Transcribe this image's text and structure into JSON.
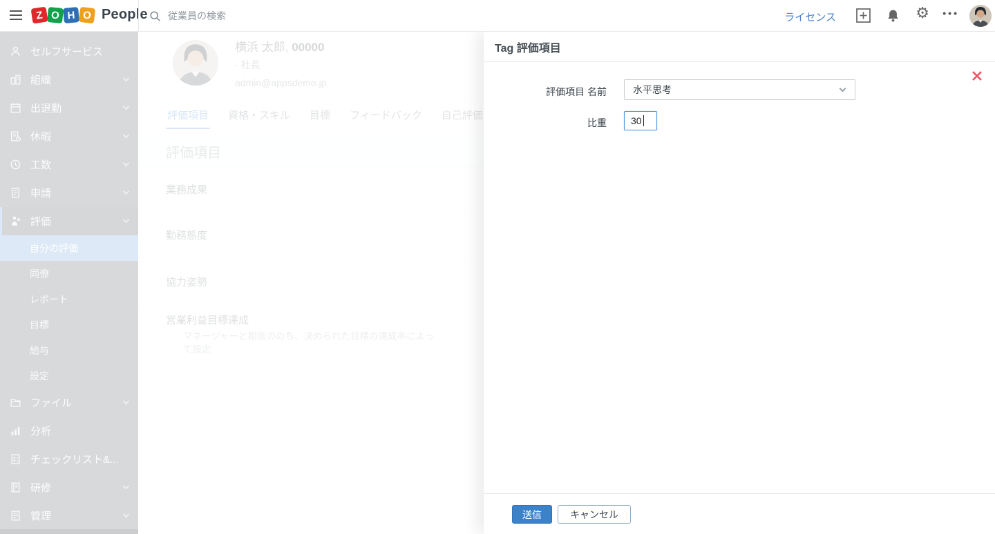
{
  "topbar": {
    "brand": {
      "tiles": [
        {
          "letter": "Z",
          "color": "#e0272c"
        },
        {
          "letter": "O",
          "color": "#12a14b"
        },
        {
          "letter": "H",
          "color": "#2d6fb7"
        },
        {
          "letter": "O",
          "color": "#f0a01f"
        }
      ],
      "product": "People"
    },
    "search_placeholder": "従業員の検索",
    "license_label": "ライセンス",
    "more_glyph": "•••",
    "gear_glyph": "⚙"
  },
  "sidebar": {
    "items": [
      {
        "label": "セルフサービス",
        "icon": "user-icon",
        "has_chevron": false
      },
      {
        "label": "組織",
        "icon": "organization-icon",
        "has_chevron": true
      },
      {
        "label": "出退勤",
        "icon": "attendance-icon",
        "has_chevron": true
      },
      {
        "label": "休暇",
        "icon": "leave-icon",
        "has_chevron": true
      },
      {
        "label": "工数",
        "icon": "timesheet-icon",
        "has_chevron": true
      },
      {
        "label": "申請",
        "icon": "request-icon",
        "has_chevron": true
      },
      {
        "label": "評価",
        "icon": "performance-icon",
        "has_chevron": true,
        "state": "active-expanded"
      },
      {
        "label": "ファイル",
        "icon": "files-icon",
        "has_chevron": true
      },
      {
        "label": "分析",
        "icon": "analytics-icon",
        "has_chevron": false
      },
      {
        "label": "チェックリスト&...",
        "icon": "checklist-icon",
        "has_chevron": false
      },
      {
        "label": "研修",
        "icon": "training-icon",
        "has_chevron": true
      },
      {
        "label": "管理",
        "icon": "admin-icon",
        "has_chevron": true
      }
    ],
    "performance_submenu": [
      {
        "label": "自分の評価",
        "active": true
      },
      {
        "label": "同僚",
        "active": false
      },
      {
        "label": "レポート",
        "active": false
      },
      {
        "label": "目標",
        "active": false
      },
      {
        "label": "給与",
        "active": false
      },
      {
        "label": "設定",
        "active": false
      }
    ]
  },
  "profile": {
    "name": "横浜 太郎,",
    "employee_id": "00000",
    "job_title": "- 社長",
    "email": "admin@appsdemo.jp"
  },
  "tabs": [
    {
      "label": "評価項目",
      "active": true
    },
    {
      "label": "資格・スキル",
      "active": false
    },
    {
      "label": "目標",
      "active": false
    },
    {
      "label": "フィードバック",
      "active": false
    },
    {
      "label": "自己評価",
      "active": false
    }
  ],
  "content": {
    "section_title": "評価項目",
    "rows": [
      {
        "title": "業務成果"
      },
      {
        "title": "勤務態度"
      },
      {
        "title": "協力姿勢"
      },
      {
        "title": "営業利益目標達成",
        "description": "マネージャーと相談ののち、決められた目標の達成率によって設定"
      }
    ]
  },
  "modal": {
    "title": "Tag 評価項目",
    "name_field": {
      "label": "評価項目 名前",
      "value": "水平思考"
    },
    "weight_field": {
      "label": "比重",
      "value": "30"
    },
    "submit_label": "送信",
    "cancel_label": "キャンセル"
  },
  "colors": {
    "accent_blue": "#4a90d9",
    "submit_blue": "#3c82c9",
    "close_red": "#ee4e5e",
    "license_blue": "#4c83cc",
    "sidebar_bg": "#4a545e",
    "sidebar_active_item_bg": "#639bd6",
    "focus_border": "#4a90e2"
  }
}
